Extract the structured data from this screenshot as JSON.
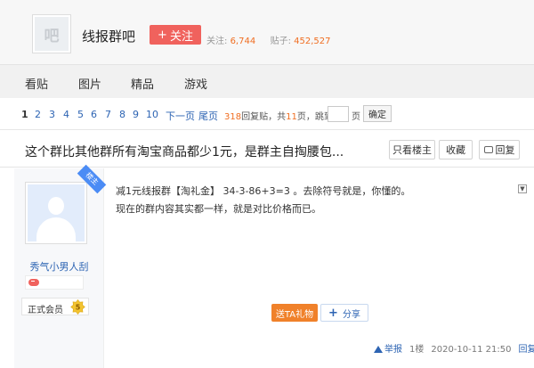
{
  "forum": {
    "logo_text": "吧",
    "name": "线报群吧",
    "follow_label": "关注",
    "follow_prefix": "+",
    "followers_label": "关注:",
    "followers": "6,744",
    "posts_label": "贴子:",
    "posts": "452,527"
  },
  "nav": [
    "看贴",
    "图片",
    "精品",
    "游戏"
  ],
  "pager": {
    "pages": [
      "1",
      "2",
      "3",
      "4",
      "5",
      "6",
      "7",
      "8",
      "9",
      "10"
    ],
    "next": "下一页",
    "last": "尾页",
    "reply_count": "318",
    "reply_label": "回复贴，共",
    "total_pages": "11",
    "total_label": "页，",
    "jump_label": "跳到",
    "page_suffix": "页",
    "confirm": "确定"
  },
  "thread": {
    "title": "这个群比其他群所有淘宝商品都少1元，是群主自掏腰包...",
    "only_host": "只看楼主",
    "collect": "收藏",
    "reply": "回复"
  },
  "post": {
    "badge": "楼主",
    "author": "秀气小男人刮",
    "member_label": "正式会员",
    "level": "5",
    "lines": [
      "减1元线报群【淘礼金】 34-3-86+3=3 。去除符号就是，你懂的。",
      "现在的群内容其实都一样，就是对比价格而已。"
    ],
    "gift": "送TA礼物",
    "share": "分享",
    "report": "举报",
    "floor": "1楼",
    "time": "2020-10-11 21:50",
    "reply": "回复"
  },
  "colors": {
    "follow": "#f0625d",
    "link": "#2d64b3",
    "accent": "#f06e22",
    "gift": "#f0812a"
  }
}
